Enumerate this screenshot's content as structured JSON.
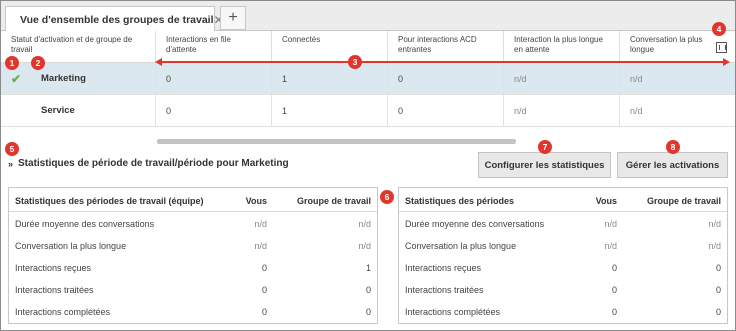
{
  "tab": {
    "label": "Vue d'ensemble des groupes de travail",
    "icon": "group-icon"
  },
  "grid": {
    "columns": [
      "Statut d'activation et de groupe de travail",
      "Interactions en file d'attente",
      "Connectés",
      "Pour interactions ACD entrantes",
      "Interaction la plus longue en attente",
      "Conversation la plus longue"
    ],
    "rows": [
      {
        "status": "✔",
        "name": "Marketing",
        "queue": "0",
        "connected": "1",
        "acd": "0",
        "longest_wait": "n/d",
        "longest_conv": "n/d"
      },
      {
        "status": "",
        "name": "Service",
        "queue": "0",
        "connected": "1",
        "acd": "0",
        "longest_wait": "n/d",
        "longest_conv": "n/d"
      }
    ]
  },
  "period": {
    "title": "Statistiques de période de travail/période pour Marketing",
    "configure_label": "Configurer les statistiques",
    "manage_label": "Gérer les activations",
    "left": {
      "headers": [
        "Statistiques des périodes de travail (équipe)",
        "Vous",
        "Groupe de travail"
      ],
      "rows": [
        [
          "Durée moyenne des conversations",
          "n/d",
          "n/d"
        ],
        [
          "Conversation la plus longue",
          "n/d",
          "n/d"
        ],
        [
          "Interactions reçues",
          "0",
          "1"
        ],
        [
          "Interactions traitées",
          "0",
          "0"
        ],
        [
          "Interactions complétées",
          "0",
          "0"
        ]
      ]
    },
    "right": {
      "headers": [
        "Statistiques des périodes",
        "Vous",
        "Groupe de travail"
      ],
      "rows": [
        [
          "Durée moyenne des conversations",
          "n/d",
          "n/d"
        ],
        [
          "Conversation la plus longue",
          "n/d",
          "n/d"
        ],
        [
          "Interactions reçues",
          "0",
          "0"
        ],
        [
          "Interactions traitées",
          "0",
          "0"
        ],
        [
          "Interactions complétées",
          "0",
          "0"
        ]
      ]
    }
  },
  "callouts": [
    "1",
    "2",
    "3",
    "4",
    "5",
    "6",
    "7",
    "8"
  ],
  "colors": {
    "callout": "#e0362c",
    "selected_row": "#dce8f0",
    "check": "#6ab04c",
    "tab_icon": "#2a8fd6"
  }
}
